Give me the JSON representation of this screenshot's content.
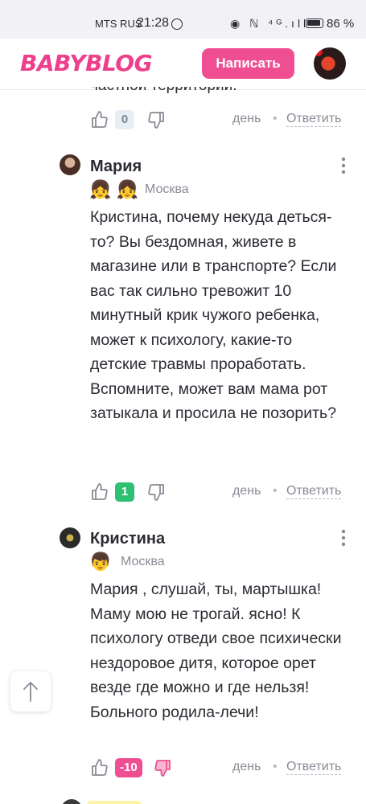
{
  "status_bar": {
    "carrier": "MTS RUS",
    "time": "21:28",
    "signal_icons": "◉ ℕ ⁴ᴳ.ıll",
    "battery": "86 %"
  },
  "header": {
    "logo": "BABYBLOG",
    "write_button": "Написать"
  },
  "previous_comment": {
    "text_fragment": "частной территории.",
    "score": "0",
    "time": "день",
    "reply": "Ответить"
  },
  "comments": [
    {
      "author": "Мария",
      "badges": "👧 👧",
      "city": "Москва",
      "text": "Кристина, почему некуда деться-то? Вы бездомная, живете в магазине или в транспорте? Если вас так сильно тревожит 10 минутный крик чужого ребенка, может к психологу, какие-то детские травмы проработать. Вспомните, может вам мама рот затыкала и просила не позорить?",
      "score": "1",
      "time": "день",
      "reply": "Ответить"
    },
    {
      "author": "Кристина",
      "badges": "👦",
      "city": "Москва",
      "text": "Мария , слушай, ты, мартышка! Маму мою не трогай. ясно! К психологу отведи свое психически нездоровое дитя, которое орет везде где можно и где нельзя! Больного родила-лечи!",
      "score": "-10",
      "time": "день",
      "reply": "Ответить"
    }
  ],
  "colors": {
    "brand_pink": "#ef4f92",
    "positive_green": "#2fc073",
    "muted_gray": "#8a8a96"
  }
}
